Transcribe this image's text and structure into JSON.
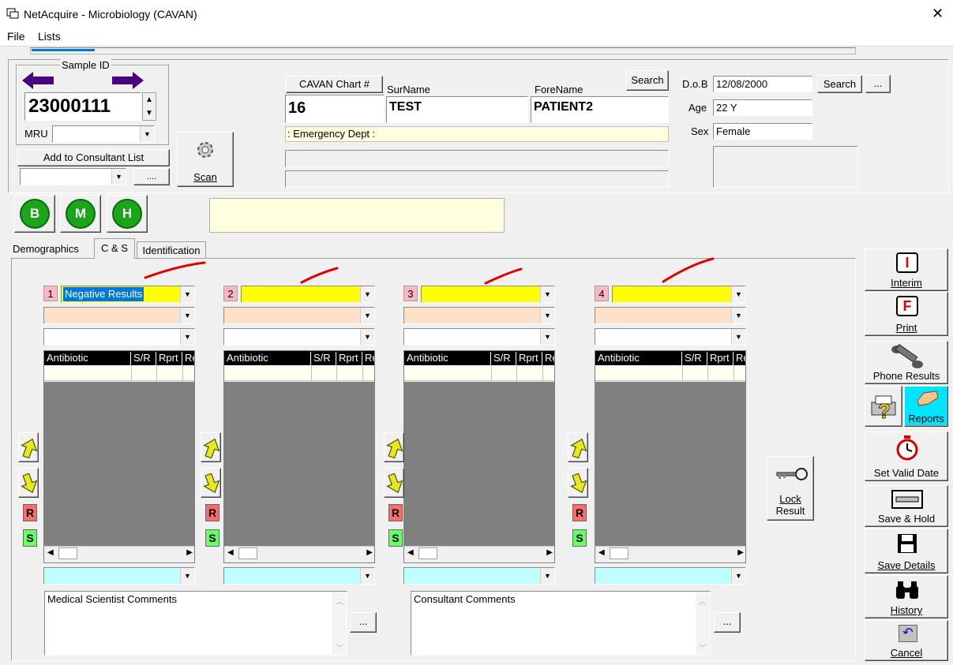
{
  "window": {
    "title": "NetAcquire - Microbiology (CAVAN)",
    "close": "✕"
  },
  "menu": {
    "file": "File",
    "lists": "Lists"
  },
  "sample": {
    "group_label": "Sample ID",
    "id_value": "23000111",
    "mru_label": "MRU",
    "mru_value": "",
    "add_consultant": "Add to Consultant List",
    "consultant_value": "",
    "ellipsis": "....",
    "scan_label": "Scan"
  },
  "patient": {
    "chart_label": "CAVAN Chart #",
    "chart_value": "16",
    "surname_label": "SurName",
    "surname_value": "TEST",
    "forename_label": "ForeName",
    "forename_value": "PATIENT2",
    "search_label": "Search",
    "location": ": Emergency Dept :",
    "dob_label": "D.o.B",
    "dob_value": "12/08/2000",
    "dob_search": "Search",
    "dob_ellipsis": "...",
    "age_label": "Age",
    "age_value": "22 Y",
    "sex_label": "Sex",
    "sex_value": "Female"
  },
  "circles": [
    "B",
    "M",
    "H"
  ],
  "tabs": [
    "Demographics",
    "C & S",
    "Identification"
  ],
  "grid_headers": [
    "Antibiotic",
    "S/R",
    "Rprt",
    "Re"
  ],
  "panels": [
    {
      "num": "1",
      "organism": "Negative Results"
    },
    {
      "num": "2",
      "organism": ""
    },
    {
      "num": "3",
      "organism": ""
    },
    {
      "num": "4",
      "organism": ""
    }
  ],
  "rs": {
    "r": "R",
    "s": "S"
  },
  "lock": {
    "line1": "Lock",
    "line2": "Result"
  },
  "comments": {
    "scientist": "Medical Scientist Comments",
    "consultant": "Consultant Comments",
    "ellipsis": "..."
  },
  "side_buttons": {
    "interim": "Interim",
    "print": "Print",
    "phone": "Phone Results",
    "reports": "Reports",
    "valid_date": "Set Valid Date",
    "save_hold": "Save & Hold",
    "save_details": "Save Details",
    "history": "History",
    "cancel": "Cancel"
  },
  "colors": {
    "organism_highlight": "#ffff00",
    "panel_number": "#ffb6c1",
    "row_peach": "#fde0c8",
    "row_cyan": "#c0ffff",
    "grid_body": "#808080",
    "circle_green": "#1aa51a",
    "annotation_red": "#e00000"
  }
}
